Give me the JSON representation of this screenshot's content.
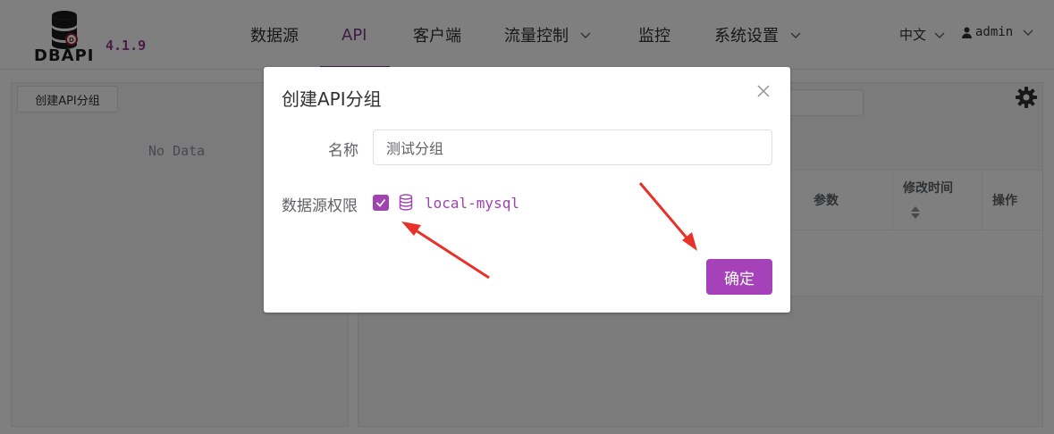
{
  "app": {
    "logo_text": "DBAPI",
    "version": "4.1.9",
    "brand_color": "#a642b9"
  },
  "nav": {
    "items": [
      {
        "label": "数据源"
      },
      {
        "label": "API"
      },
      {
        "label": "客户端"
      },
      {
        "label": "流量控制"
      },
      {
        "label": "监控"
      },
      {
        "label": "系统设置"
      }
    ],
    "active": "API",
    "language": "中文",
    "user": "admin"
  },
  "left_panel": {
    "create_group_label": "创建API分组",
    "empty_text": "No Data"
  },
  "table": {
    "columns": [
      {
        "label": "参数"
      },
      {
        "label": "修改时间"
      },
      {
        "label": "操作"
      }
    ]
  },
  "dialog": {
    "title": "创建API分组",
    "name_label": "名称",
    "name_value": "测试分组",
    "permission_label": "数据源权限",
    "datasource": {
      "name": "local-mysql",
      "checked": true
    },
    "confirm_label": "确定"
  }
}
